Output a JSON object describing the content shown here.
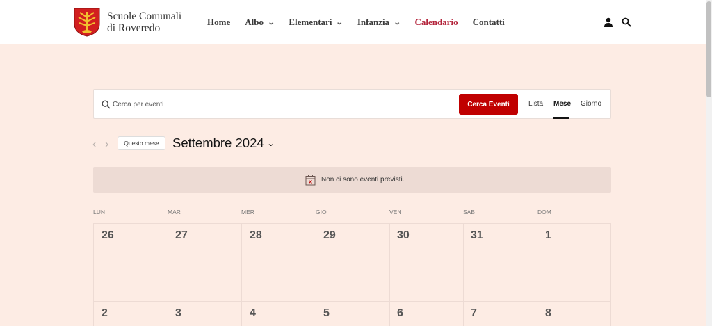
{
  "header": {
    "site_name_line1": "Scuole Comunali",
    "site_name_line2": "di Roveredo",
    "nav": [
      {
        "label": "Home",
        "has_dropdown": false
      },
      {
        "label": "Albo",
        "has_dropdown": true
      },
      {
        "label": "Elementari",
        "has_dropdown": true
      },
      {
        "label": "Infanzia",
        "has_dropdown": true
      },
      {
        "label": "Calendario",
        "has_dropdown": false,
        "active": true
      },
      {
        "label": "Contatti",
        "has_dropdown": false
      }
    ],
    "icons": [
      "user-icon",
      "search-icon"
    ]
  },
  "search": {
    "placeholder": "Cerca per eventi",
    "button_label": "Cerca Eventi",
    "views": [
      "Lista",
      "Mese",
      "Giorno"
    ],
    "active_view": "Mese"
  },
  "month_nav": {
    "today_label": "Questo mese",
    "title": "Settembre 2024"
  },
  "notice": {
    "text": "Non ci sono eventi previsti."
  },
  "calendar": {
    "weekdays": [
      "LUN",
      "MAR",
      "MER",
      "GIO",
      "VEN",
      "SAB",
      "DOM"
    ],
    "weeks": [
      [
        "26",
        "27",
        "28",
        "29",
        "30",
        "31",
        "1"
      ],
      [
        "2",
        "3",
        "4",
        "5",
        "6",
        "7",
        "8"
      ]
    ]
  },
  "colors": {
    "accent": "#c00000",
    "active_nav": "#b3233a",
    "page_bg": "#fdece4",
    "notice_bg": "#eddbd4"
  }
}
